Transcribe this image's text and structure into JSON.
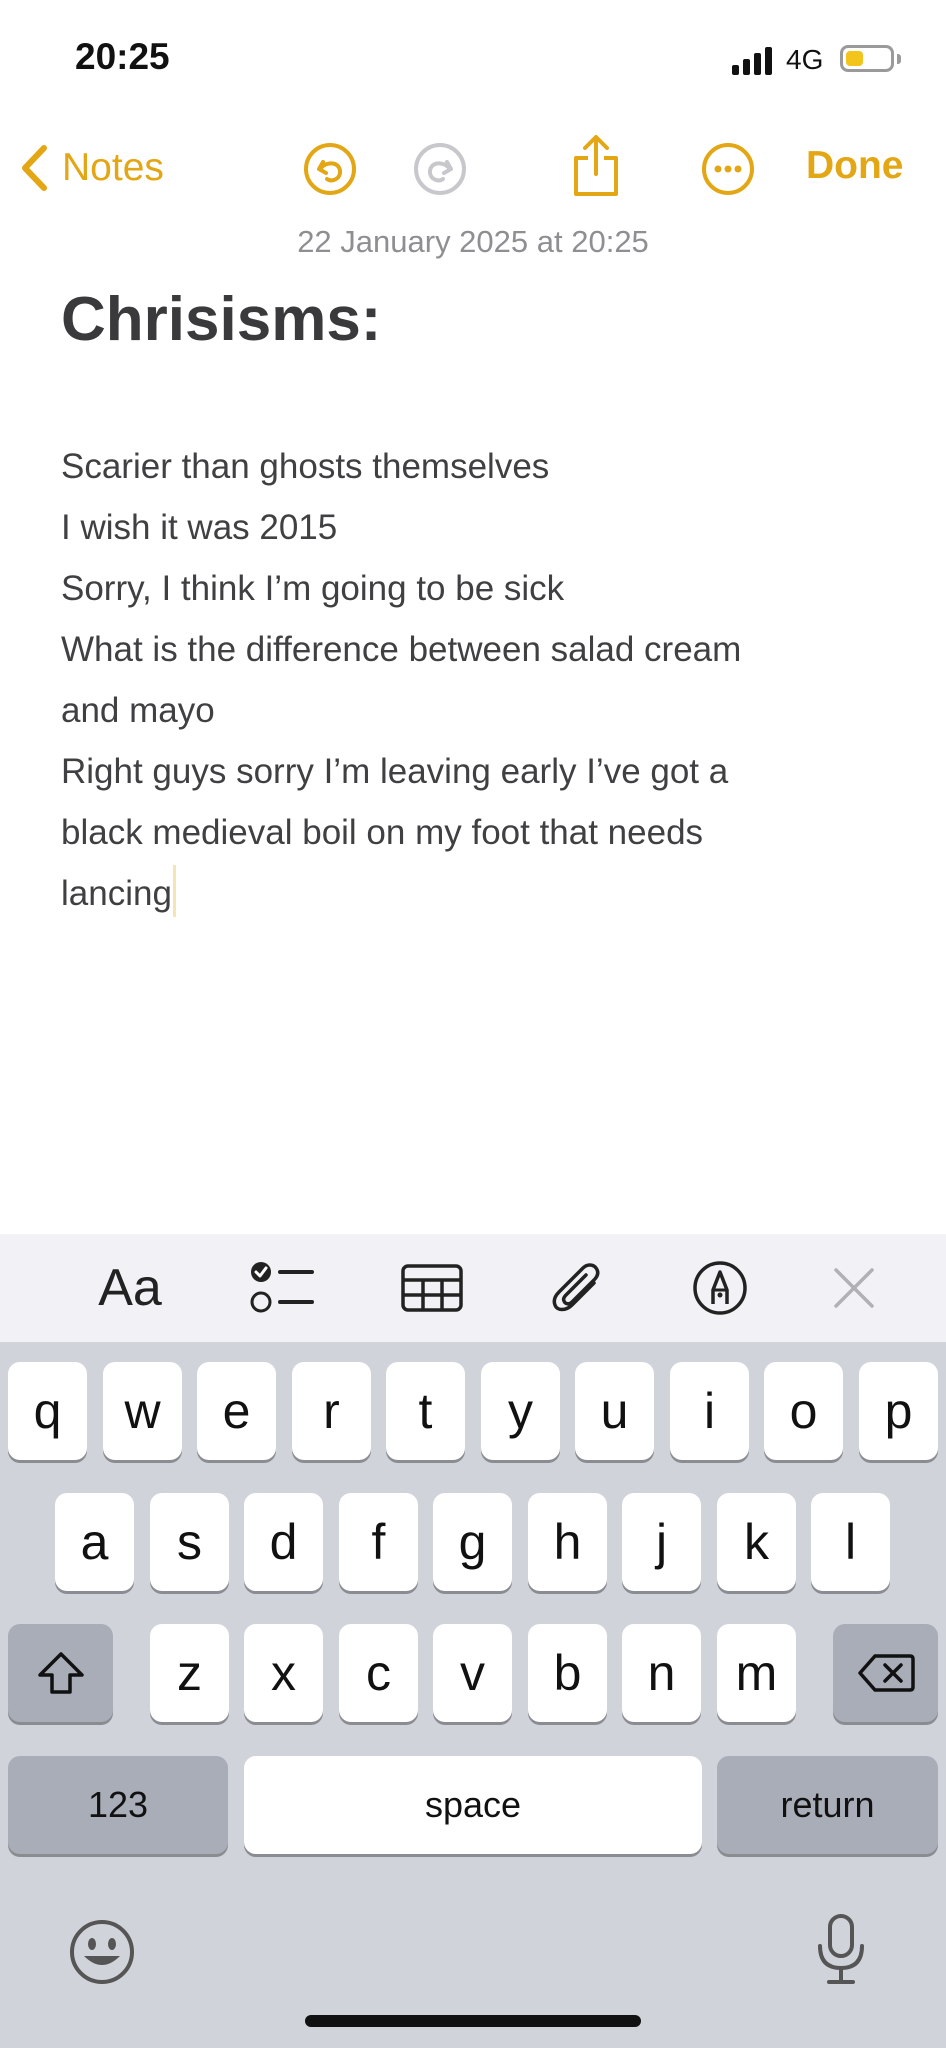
{
  "status_bar": {
    "time": "20:25",
    "network": "4G",
    "battery_level": 0.4
  },
  "nav": {
    "back_label": "Notes",
    "done_label": "Done"
  },
  "note": {
    "date": "22 January 2025 at 20:25",
    "title": "Chrisisms:",
    "lines": [
      "Scarier than ghosts themselves",
      "I wish it was 2015",
      "Sorry, I think I’m going to be sick",
      "What is the difference between salad cream",
      "and mayo",
      "Right guys sorry I’m leaving early I’ve got a",
      "black medieval boil on my foot that needs",
      "lancing"
    ]
  },
  "toolbar": {
    "format_label": "Aa"
  },
  "keyboard": {
    "row1": [
      "q",
      "w",
      "e",
      "r",
      "t",
      "y",
      "u",
      "i",
      "o",
      "p"
    ],
    "row2": [
      "a",
      "s",
      "d",
      "f",
      "g",
      "h",
      "j",
      "k",
      "l"
    ],
    "row3": [
      "z",
      "x",
      "c",
      "v",
      "b",
      "n",
      "m"
    ],
    "numbers_label": "123",
    "space_label": "space",
    "return_label": "return"
  },
  "colors": {
    "accent": "#e3a715",
    "keyboard_bg": "#d0d3da",
    "toolbar_bg": "#f2f2f6"
  }
}
